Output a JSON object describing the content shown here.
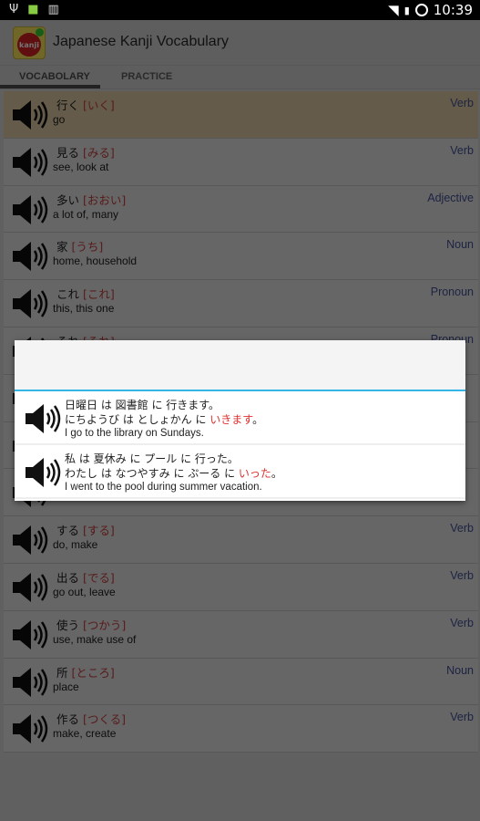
{
  "status": {
    "time": "10:39"
  },
  "app": {
    "title": "Japanese Kanji Vocabulary",
    "logo_text": "kanji"
  },
  "tabs": [
    {
      "label": "VOCABOLARY",
      "active": true
    },
    {
      "label": "PRACTICE",
      "active": false
    }
  ],
  "colors": {
    "reading": "#d44444",
    "type": "#4a5aa8",
    "highlight_row": "#fbe3b8",
    "accent": "#33b5e5"
  },
  "vocab": [
    {
      "kanji": "行く",
      "reading": "[いく]",
      "meaning": "go",
      "type": "Verb",
      "selected": true
    },
    {
      "kanji": "見る",
      "reading": "[みる]",
      "meaning": "see, look at",
      "type": "Verb"
    },
    {
      "kanji": "多い",
      "reading": "[おおい]",
      "meaning": "a lot of, many",
      "type": "Adjective"
    },
    {
      "kanji": "家",
      "reading": "[うち]",
      "meaning": "home, household",
      "type": "Noun"
    },
    {
      "kanji": "これ",
      "reading": "[これ]",
      "meaning": "this, this one",
      "type": "Pronoun"
    },
    {
      "kanji": "それ",
      "reading": "[それ]",
      "meaning": "",
      "type": "Pronoun"
    },
    {
      "kanji": "",
      "reading": "",
      "meaning": "",
      "type": ""
    },
    {
      "kanji": "",
      "reading": "",
      "meaning": "",
      "type": ""
    },
    {
      "kanji": "",
      "reading": "",
      "meaning": "",
      "type": ""
    },
    {
      "kanji": "する",
      "reading": "[する]",
      "meaning": "do, make",
      "type": "Verb"
    },
    {
      "kanji": "出る",
      "reading": "[でる]",
      "meaning": "go out, leave",
      "type": "Verb"
    },
    {
      "kanji": "使う",
      "reading": "[つかう]",
      "meaning": "use, make use of",
      "type": "Verb"
    },
    {
      "kanji": "所",
      "reading": "[ところ]",
      "meaning": "place",
      "type": "Noun"
    },
    {
      "kanji": "作る",
      "reading": "[つくる]",
      "meaning": "make, create",
      "type": "Verb"
    }
  ],
  "dialog": {
    "examples": [
      {
        "japanese": "日曜日 は 図書館 に 行きます。",
        "kana_pre": "にちようび は としょかん に ",
        "kana_hl": "いきます",
        "kana_post": "。",
        "english": "I go to the library on Sundays."
      },
      {
        "japanese": "私 は 夏休み に プール に 行った。",
        "kana_pre": "わたし は なつやすみ に ぷーる に ",
        "kana_hl": "いった",
        "kana_post": "。",
        "english": "I went to the pool during summer vacation."
      }
    ]
  }
}
